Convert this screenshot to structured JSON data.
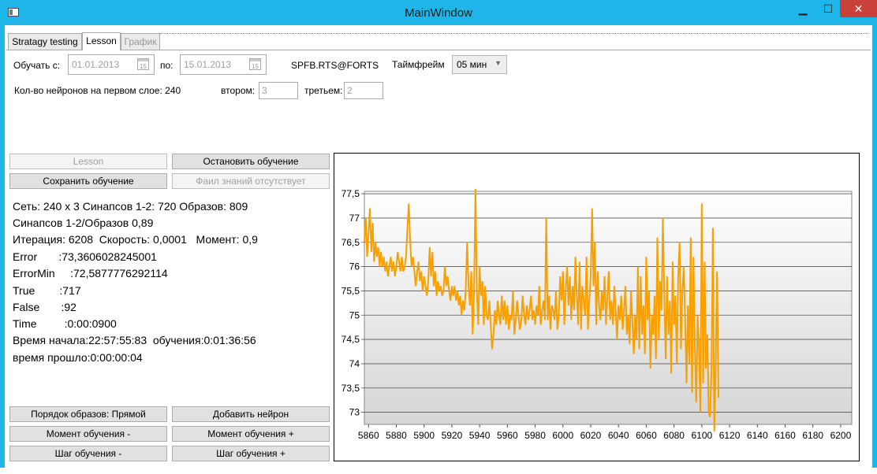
{
  "window": {
    "title": "MainWindow",
    "minimize": "▁",
    "maximize": "☐",
    "close": "✕"
  },
  "tabs": [
    {
      "label": "Stratagy testing"
    },
    {
      "label": "Lesson"
    },
    {
      "label": "График"
    }
  ],
  "form": {
    "train_from_label": "Обучать с:",
    "date_from": "01.01.2013",
    "to_label": "по:",
    "date_to": "15.01.2013",
    "calendar_day": "15",
    "instrument": "SPFB.RTS@FORTS",
    "timeframe_label": "Таймфрейм",
    "timeframe_value": "05 мин",
    "neurons_first_label": "Кол-во нейронов на первом слое: 240",
    "second_label": "втором:",
    "second_value": "3",
    "third_label": "третьем:",
    "third_value": "2"
  },
  "buttons": {
    "lesson": "Lesson",
    "stop_training": "Остановить обучение",
    "save_training": "Сохранить обучение",
    "knowledge_file_missing": "Фаил знаний отсутствует",
    "sample_order": "Порядок образов: Прямой",
    "add_neuron": "Добавить нейрон",
    "moment_minus": "Момент обучения -",
    "moment_plus": "Момент обучения +",
    "step_minus": "Шаг обучения -",
    "step_plus": "Шаг обучения +"
  },
  "info": [
    "Сеть: 240 x 3 Синапсов 1-2: 720 Образов: 809",
    "Синапсов 1-2/Образов 0,89",
    "Итерация: 6208  Скорость: 0,0001   Момент: 0,9",
    "Error       :73,3606028245001",
    "ErrorMin     :72,5877776292114",
    "True        :717",
    "False       :92",
    "Time         :0:00:0900",
    "Время начала:22:57:55:83  обучения:0:01:36:56",
    "время прошло:0:00:00:04"
  ],
  "chart_data": {
    "type": "line",
    "title": "",
    "xlabel": "",
    "ylabel": "",
    "xlim": [
      5857,
      6208
    ],
    "ylim": [
      72.75,
      77.55
    ],
    "x_ticks": [
      "5860",
      "5880",
      "5900",
      "5920",
      "5940",
      "5960",
      "5980",
      "6000",
      "6020",
      "6040",
      "6060",
      "6080",
      "6100",
      "6120",
      "6140",
      "6160",
      "6180",
      "6200"
    ],
    "y_ticks": [
      "77,5",
      "77",
      "76,5",
      "76",
      "75,5",
      "75",
      "74,5",
      "74",
      "73,5",
      "73"
    ],
    "grid": true,
    "line_color": "#f7a000",
    "x_start": 5857,
    "x_step": 1,
    "series": [
      {
        "values": [
          76.5,
          77.0,
          76.2,
          76.7,
          77.2,
          76.3,
          76.9,
          76.1,
          76.5,
          76.2,
          76.4,
          76.0,
          76.3,
          76.0,
          76.2,
          75.9,
          76.1,
          75.8,
          76.0,
          76.2,
          75.9,
          76.1,
          75.8,
          76.0,
          76.3,
          76.1,
          75.9,
          76.2,
          75.9,
          76.0,
          76.2,
          76.8,
          77.3,
          76.5,
          76.0,
          76.2,
          75.9,
          75.6,
          75.9,
          76.1,
          75.7,
          75.9,
          75.5,
          75.8,
          75.6,
          75.4,
          75.7,
          76.4,
          75.8,
          76.3,
          75.6,
          75.9,
          75.4,
          75.7,
          75.5,
          75.6,
          75.4,
          75.5,
          76.0,
          75.6,
          75.8,
          75.5,
          75.3,
          75.6,
          75.4,
          75.6,
          75.3,
          75.5,
          75.2,
          75.4,
          75.0,
          75.3,
          75.1,
          75.5,
          76.5,
          75.6,
          75.2,
          75.9,
          74.6,
          75.5,
          77.6,
          75.5,
          74.8,
          76.0,
          75.4,
          75.7,
          74.8,
          75.6,
          75.0,
          74.9,
          75.3,
          74.8,
          74.3,
          74.6,
          75.1,
          74.8,
          75.3,
          75.0,
          74.8,
          75.4,
          74.9,
          75.3,
          74.8,
          75.2,
          74.7,
          75.0,
          74.9,
          75.5,
          74.6,
          74.9,
          75.3,
          75.0,
          74.7,
          74.9,
          75.4,
          75.0,
          74.8,
          75.2,
          74.9,
          75.1,
          75.4,
          74.9,
          75.1,
          74.8,
          75.2,
          75.0,
          75.6,
          74.8,
          75.1,
          75.3,
          74.9,
          77.0,
          74.9,
          75.4,
          74.7,
          75.2,
          75.1,
          74.9,
          75.5,
          74.7,
          75.0,
          75.8,
          75.3,
          75.9,
          74.8,
          75.5,
          76.0,
          75.2,
          75.8,
          74.9,
          75.6,
          75.1,
          76.2,
          75.4,
          74.8,
          76.1,
          74.7,
          75.6,
          75.3,
          75.0,
          76.2,
          74.7,
          75.3,
          75.8,
          77.2,
          75.6,
          76.5,
          74.8,
          75.9,
          75.2,
          74.9,
          75.5,
          75.1,
          75.8,
          74.8,
          75.4,
          75.9,
          74.9,
          75.3,
          74.8,
          75.6,
          75.1,
          74.5,
          75.2,
          74.9,
          75.4,
          74.7,
          75.1,
          75.6,
          74.6,
          75.0,
          74.4,
          75.5,
          74.9,
          74.2,
          75.0,
          74.5,
          76.0,
          74.3,
          75.8,
          74.6,
          75.2,
          74.2,
          76.2,
          74.9,
          75.5,
          73.9,
          75.0,
          74.6,
          75.4,
          74.1,
          76.6,
          74.5,
          75.7,
          75.1,
          77.0,
          75.4,
          74.1,
          75.8,
          74.6,
          75.3,
          73.8,
          76.1,
          74.8,
          75.4,
          74.0,
          75.8,
          76.5,
          74.3,
          75.5,
          76.0,
          74.9,
          73.6,
          75.2,
          74.0,
          76.6,
          73.4,
          76.2,
          74.4,
          73.2,
          75.0,
          74.3,
          73.0,
          77.3,
          73.6,
          76.1,
          73.9,
          74.6,
          73.0,
          72.9,
          73.9,
          76.8,
          72.6,
          74.0,
          75.9,
          73.3
        ]
      }
    ]
  }
}
